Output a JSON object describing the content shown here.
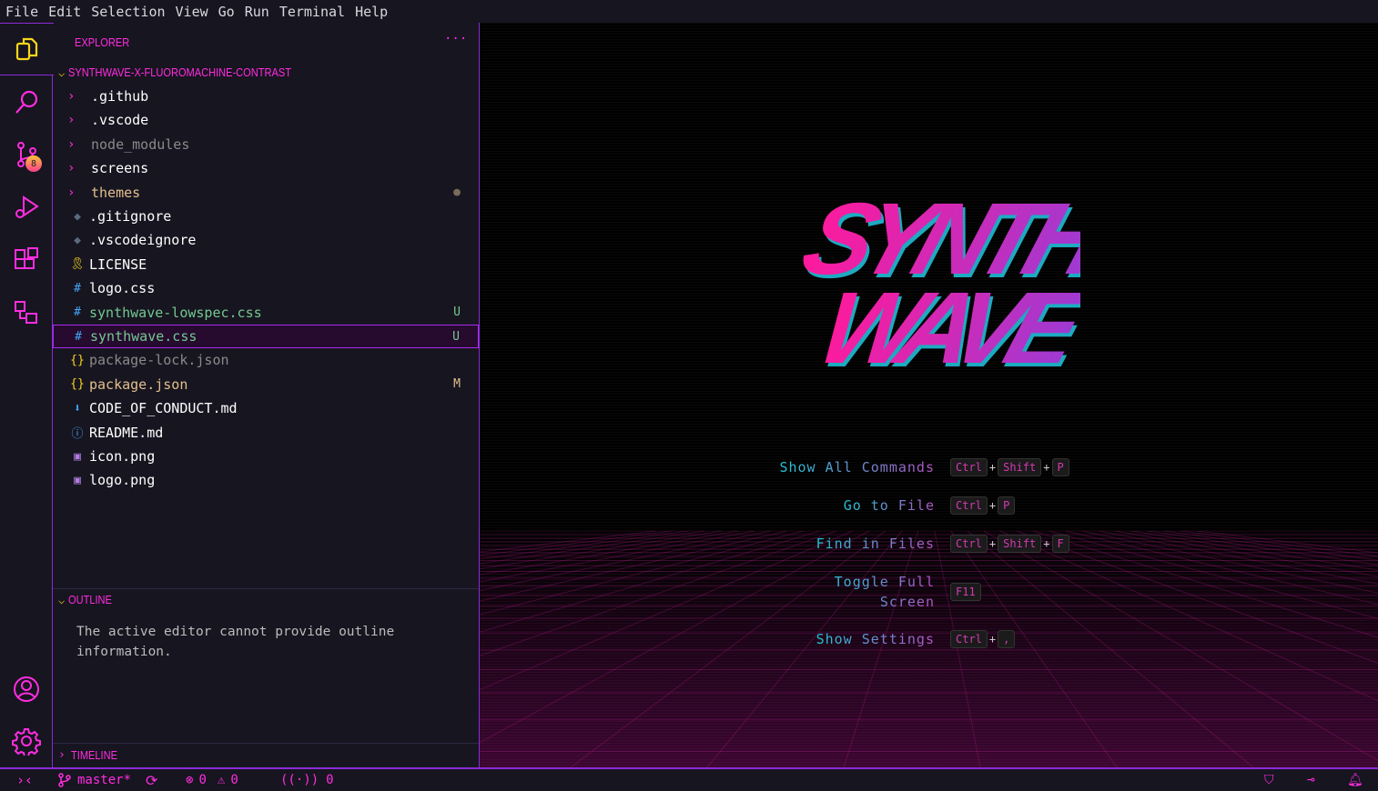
{
  "menu": [
    "File",
    "Edit",
    "Selection",
    "View",
    "Go",
    "Run",
    "Terminal",
    "Help"
  ],
  "activity": {
    "scm_badge": "8"
  },
  "explorer": {
    "title": "EXPLORER",
    "more": "···",
    "root": "SYNTHWAVE-X-FLUOROMACHINE-CONTRAST",
    "items": [
      {
        "name": ".github",
        "type": "folder",
        "color": "#ffffff",
        "status": ""
      },
      {
        "name": ".vscode",
        "type": "folder",
        "color": "#ffffff",
        "status": ""
      },
      {
        "name": "node_modules",
        "type": "folder",
        "color": "#8a8a8a",
        "status": ""
      },
      {
        "name": "screens",
        "type": "folder",
        "color": "#ffffff",
        "status": ""
      },
      {
        "name": "themes",
        "type": "folder",
        "color": "#e2c08d",
        "status": "●"
      },
      {
        "name": ".gitignore",
        "type": "git",
        "color": "#ffffff",
        "status": ""
      },
      {
        "name": ".vscodeignore",
        "type": "git",
        "color": "#ffffff",
        "status": ""
      },
      {
        "name": "LICENSE",
        "type": "license",
        "color": "#ffffff",
        "status": ""
      },
      {
        "name": "logo.css",
        "type": "css",
        "color": "#ffffff",
        "status": ""
      },
      {
        "name": "synthwave-lowspec.css",
        "type": "css",
        "color": "#73c991",
        "status": "U"
      },
      {
        "name": "synthwave.css",
        "type": "css",
        "color": "#73c991",
        "status": "U",
        "selected": true
      },
      {
        "name": "package-lock.json",
        "type": "json",
        "color": "#8a8a8a",
        "status": ""
      },
      {
        "name": "package.json",
        "type": "json",
        "color": "#e2c08d",
        "status": "M"
      },
      {
        "name": "CODE_OF_CONDUCT.md",
        "type": "md-down",
        "color": "#ffffff",
        "status": ""
      },
      {
        "name": "README.md",
        "type": "info",
        "color": "#ffffff",
        "status": ""
      },
      {
        "name": "icon.png",
        "type": "image",
        "color": "#ffffff",
        "status": ""
      },
      {
        "name": "logo.png",
        "type": "image",
        "color": "#ffffff",
        "status": ""
      }
    ]
  },
  "outline": {
    "title": "OUTLINE",
    "message": "The active editor cannot provide outline information."
  },
  "timeline": {
    "title": "TIMELINE"
  },
  "logo": {
    "line1": "SYNTH",
    "line2": "WAVE"
  },
  "commands": [
    {
      "label": "Show All Commands",
      "keys": [
        "Ctrl",
        "Shift",
        "P"
      ]
    },
    {
      "label": "Go to File",
      "keys": [
        "Ctrl",
        "P"
      ]
    },
    {
      "label": "Find in Files",
      "keys": [
        "Ctrl",
        "Shift",
        "F"
      ]
    },
    {
      "label": "Toggle Full Screen",
      "keys": [
        "F11"
      ]
    },
    {
      "label": "Show Settings",
      "keys": [
        "Ctrl",
        ","
      ]
    }
  ],
  "status": {
    "branch": "master*",
    "errors": "0",
    "warnings": "0",
    "ports": "0"
  }
}
